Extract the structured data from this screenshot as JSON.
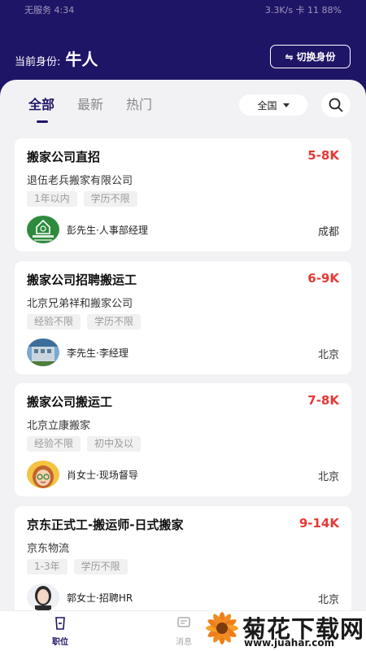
{
  "status_bar": {
    "left": "无服务 4:34",
    "right": "3.3K/s 卡 11 88%"
  },
  "header": {
    "identity_label": "当前身份:",
    "identity_value": "牛人",
    "switch_label": "切换身份"
  },
  "tabs": [
    {
      "label": "全部",
      "active": true
    },
    {
      "label": "最新",
      "active": false
    },
    {
      "label": "热门",
      "active": false
    }
  ],
  "region": {
    "value": "全国"
  },
  "jobs": [
    {
      "title": "搬家公司直招",
      "salary": "5-8K",
      "company": "退伍老兵搬家有限公司",
      "tags": [
        "1年以内",
        "学历不限"
      ],
      "recruiter": "彭先生·人事部经理",
      "city": "成都",
      "avatar_icon": "company-logo-green"
    },
    {
      "title": "搬家公司招聘搬运工",
      "salary": "6-9K",
      "company": "北京兄弟祥和搬家公司",
      "tags": [
        "经验不限",
        "学历不限"
      ],
      "recruiter": "李先生·李经理",
      "city": "北京",
      "avatar_icon": "building-photo"
    },
    {
      "title": "搬家公司搬运工",
      "salary": "7-8K",
      "company": "北京立康搬家",
      "tags": [
        "经验不限",
        "初中及以"
      ],
      "recruiter": "肖女士·现场督导",
      "city": "北京",
      "avatar_icon": "cartoon-woman-avatar"
    },
    {
      "title": "京东正式工-搬运师-日式搬家",
      "salary": "9-14K",
      "company": "京东物流",
      "tags": [
        "1-3年",
        "学历不限"
      ],
      "recruiter": "郭女士·招聘HR",
      "city": "北京",
      "avatar_icon": "woman-photo"
    }
  ],
  "tabbar": [
    {
      "label": "职位",
      "icon": "briefcase-icon",
      "active": true
    },
    {
      "label": "消息",
      "icon": "message-icon",
      "active": false
    }
  ],
  "watermark": {
    "text": "菊花下载网",
    "url": "www.juahar.com"
  },
  "colors": {
    "primary": "#1f1567",
    "salary": "#e53935",
    "background": "#f2f2f5"
  }
}
